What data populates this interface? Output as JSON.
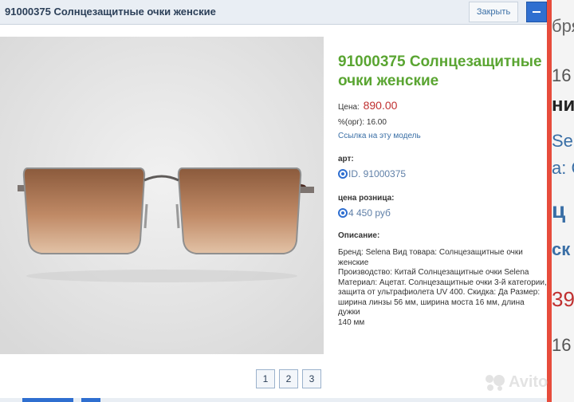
{
  "window": {
    "title": "91000375 Солнцезащитные очки женские",
    "close_label": "Закрыть"
  },
  "product": {
    "title": "91000375 Солнцезащитные очки женские",
    "price_label": "Цена:",
    "price_value": "890.00",
    "org_text": "%(орг): 16.00",
    "link_text": "Ссылка на эту модель",
    "art_label": "арт:",
    "art_value": "ID. 91000375",
    "retail_label": "цена розница:",
    "retail_value": "4 450 руб",
    "desc_label": "Описание:",
    "description": "Бренд: Selena Вид товара: Солнцезащитные очки женские\nПроизводство: Китай Солнцезащитные очки Selena\nМатериал: Ацетат. Солнцезащитные очки 3-й категории,\nзащита от ультрафиолета UV 400. Скидка: Да Размер:\nширина линзы 56 мм, ширина моста 16 мм, длина дужки\n140 мм"
  },
  "pagination": [
    "1",
    "2",
    "3"
  ],
  "background": {
    "fragments": [
      "бря",
      "16",
      "ние",
      "Se",
      "а: С",
      "ц",
      "ск",
      "39",
      "16"
    ]
  },
  "watermark": "Avito",
  "colors": {
    "accent": "#2f6fd0",
    "title_green": "#5aa532",
    "price_red": "#c03030",
    "bg_red": "#e74c3c"
  }
}
